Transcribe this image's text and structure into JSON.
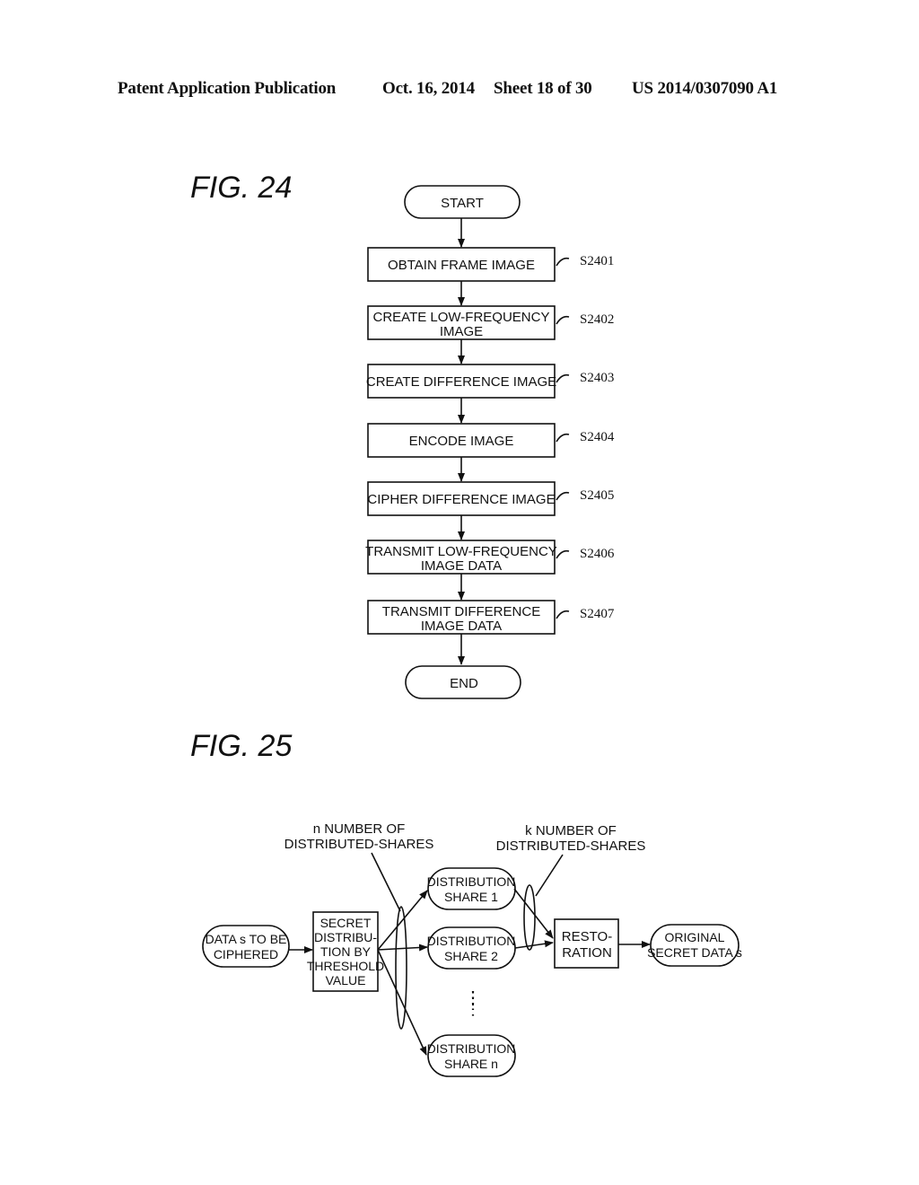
{
  "header": {
    "publication": "Patent Application Publication",
    "date": "Oct. 16, 2014",
    "sheet": "Sheet 18 of 30",
    "number": "US 2014/0307090 A1"
  },
  "fig24": {
    "title": "FIG. 24",
    "start": "START",
    "end": "END",
    "steps": [
      {
        "lines": [
          "OBTAIN FRAME IMAGE"
        ],
        "id": "S2401"
      },
      {
        "lines": [
          "CREATE LOW-FREQUENCY",
          "IMAGE"
        ],
        "id": "S2402"
      },
      {
        "lines": [
          "CREATE DIFFERENCE IMAGE"
        ],
        "id": "S2403"
      },
      {
        "lines": [
          "ENCODE IMAGE"
        ],
        "id": "S2404"
      },
      {
        "lines": [
          "CIPHER DIFFERENCE IMAGE"
        ],
        "id": "S2405"
      },
      {
        "lines": [
          "TRANSMIT LOW-FREQUENCY",
          "IMAGE DATA"
        ],
        "id": "S2406"
      },
      {
        "lines": [
          "TRANSMIT DIFFERENCE",
          "IMAGE DATA"
        ],
        "id": "S2407"
      }
    ]
  },
  "fig25": {
    "title": "FIG. 25",
    "input": [
      "DATA s TO BE",
      "CIPHERED"
    ],
    "process": [
      "SECRET",
      "DISTRIBU-",
      "TION BY",
      "THRESHOLD",
      "VALUE"
    ],
    "shares": [
      [
        "DISTRIBUTION",
        "SHARE 1"
      ],
      [
        "DISTRIBUTION",
        "SHARE 2"
      ],
      [
        "DISTRIBUTION",
        "SHARE n"
      ]
    ],
    "ellipsis": "⋮",
    "n_label": [
      "n NUMBER OF",
      "DISTRIBUTED-SHARES"
    ],
    "k_label": [
      "k NUMBER OF",
      "DISTRIBUTED-SHARES"
    ],
    "restoration": [
      "RESTO-",
      "RATION"
    ],
    "output": [
      "ORIGINAL",
      "SECRET DATA s"
    ]
  }
}
